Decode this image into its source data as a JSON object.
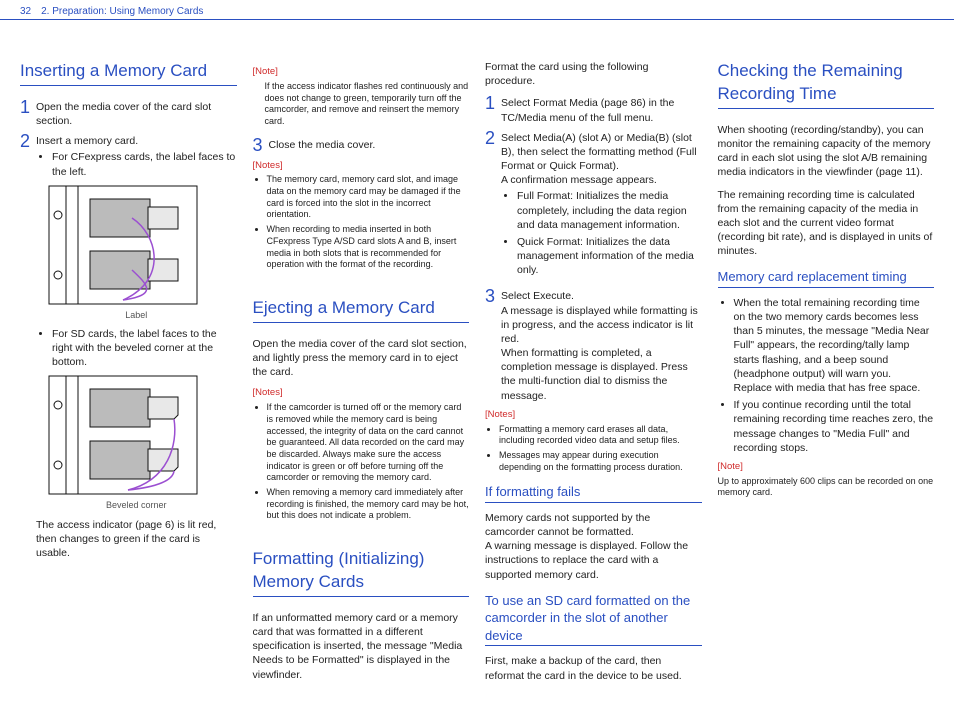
{
  "header": {
    "page_number": "32",
    "section": "2. Preparation: Using Memory Cards"
  },
  "col1": {
    "h_inserting": "Inserting a Memory Card",
    "s1_num": "1",
    "s1_text": "Open the media cover of the card slot section.",
    "s2_num": "2",
    "s2_text": "Insert a memory card.",
    "s2_b1": "For CFexpress cards, the label faces to the left.",
    "fig1_cap": "Label",
    "s2_b2": "For SD cards, the label faces to the right with the beveled corner at the bottom.",
    "fig2_cap": "Beveled corner",
    "p_access": "The access indicator (page 6) is lit red, then changes to green if the card is usable."
  },
  "col2": {
    "note_lbl1": "[Note]",
    "note1": "If the access indicator flashes red continuously and does not change to green, temporarily turn off the camcorder, and remove and reinsert the memory card.",
    "s3_num": "3",
    "s3_text": "Close the media cover.",
    "notes_lbl2": "[Notes]",
    "n2a": "The memory card, memory card slot, and image data on the memory card may be damaged if the card is forced into the slot in the incorrect orientation.",
    "n2b": "When recording to media inserted in both CFexpress Type A/SD card slots A and B, insert media in both slots that is recommended for operation with the format of the recording.",
    "h_ejecting": "Ejecting a Memory Card",
    "p_eject": "Open the media cover of the card slot section, and lightly press the memory card in to eject the card.",
    "notes_lbl3": "[Notes]",
    "n3a": "If the camcorder is turned off or the memory card is removed while the memory card is being accessed, the integrity of data on the card cannot be guaranteed. All data recorded on the card may be discarded. Always make sure the access indicator is green or off before turning off the camcorder or removing the memory card.",
    "n3b": "When removing a memory card immediately after recording is finished, the memory card may be hot, but this does not indicate a problem.",
    "h_formatting": "Formatting (Initializing) Memory Cards",
    "p_format_intro": "If an unformatted memory card or a memory card that was formatted in a different specification is inserted, the message \"Media Needs to be Formatted\" is displayed in the viewfinder."
  },
  "col3": {
    "p_top": "Format the card using the following procedure.",
    "s1_num": "1",
    "s1_text": "Select Format Media (page 86) in the TC/Media menu of the full menu.",
    "s2_num": "2",
    "s2_text": "Select Media(A) (slot A) or Media(B) (slot B), then select the formatting method (Full Format or Quick Format).",
    "s2_confirm": "A confirmation message appears.",
    "s2_b1": "Full Format: Initializes the media completely, including the data region and data management information.",
    "s2_b2": "Quick Format: Initializes the data management information of the media only.",
    "s3_num": "3",
    "s3_text": "Select Execute.",
    "s3_p1": "A message is displayed while formatting is in progress, and the access indicator is lit red.",
    "s3_p2": "When formatting is completed, a completion message is displayed. Press the multi-function dial to dismiss the message.",
    "notes_lbl": "[Notes]",
    "n1": "Formatting a memory card erases all data, including recorded video data and setup files.",
    "n2": "Messages may appear during execution depending on the formatting process duration.",
    "h_fails": "If formatting fails",
    "p_fails": "Memory cards not supported by the camcorder cannot be formatted.\nA warning message is displayed. Follow the instructions to replace the card with a supported memory card.",
    "h_sd": "To use an SD card formatted on the camcorder in the slot of another device",
    "p_sd": "First, make a backup of the card, then reformat the card in the device to be used."
  },
  "col4": {
    "h_checking": "Checking the Remaining Recording Time",
    "p1": "When shooting (recording/standby), you can monitor the remaining capacity of the memory card in each slot using the slot A/B remaining media indicators in the viewfinder (page 11).",
    "p2": "The remaining recording time is calculated from the remaining capacity of the media in each slot and the current video format (recording bit rate), and is displayed in units of minutes.",
    "h_timing": "Memory card replacement timing",
    "b1": "When the total remaining recording time on the two memory cards becomes less than 5 minutes, the message \"Media Near Full\" appears, the recording/tally lamp starts flashing, and a beep sound (headphone output) will warn you.\nReplace with media that has free space.",
    "b2": "If you continue recording until the total remaining recording time reaches zero, the message changes to \"Media Full\" and recording stops.",
    "note_lbl": "[Note]",
    "note": "Up to approximately 600 clips can be recorded on one memory card."
  }
}
